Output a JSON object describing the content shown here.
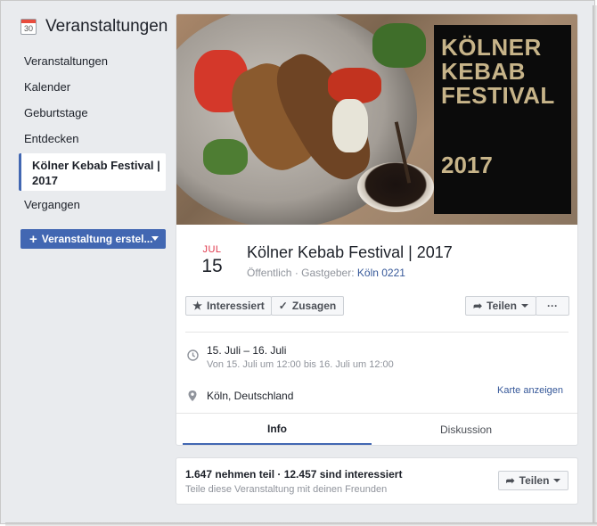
{
  "sidebar": {
    "calendar_day": "30",
    "title": "Veranstaltungen",
    "items": [
      {
        "label": "Veranstaltungen"
      },
      {
        "label": "Kalender"
      },
      {
        "label": "Geburtstage"
      },
      {
        "label": "Entdecken"
      },
      {
        "label": "Kölner Kebab Festival | 2017"
      },
      {
        "label": "Vergangen"
      }
    ],
    "create_button": "Veranstaltung erstel..."
  },
  "event": {
    "cover": {
      "poster_title": "KÖLNER KEBAB FESTIVAL",
      "poster_year": "2017"
    },
    "month": "JUL",
    "day": "15",
    "title": "Kölner Kebab Festival | 2017",
    "visibility": "Öffentlich",
    "host_prefix": "Gastgeber:",
    "host": "Köln 0221",
    "actions": {
      "interested": "Interessiert",
      "going": "Zusagen",
      "share": "Teilen",
      "more": "···"
    },
    "when_main": "15. Juli – 16. Juli",
    "when_sub": "Von 15. Juli um 12:00 bis 16. Juli um 12:00",
    "where": "Köln, Deutschland",
    "map_link": "Karte anzeigen",
    "tabs": [
      {
        "label": "Info",
        "active": true
      },
      {
        "label": "Diskussion",
        "active": false
      }
    ]
  },
  "attendance": {
    "stats": "1.647 nehmen teil · 12.457 sind interessiert",
    "sub": "Teile diese Veranstaltung mit deinen Freunden",
    "share": "Teilen"
  },
  "colors": {
    "accent": "#4267b2",
    "link": "#365899",
    "month": "#e0394d",
    "background": "#e9ebee"
  }
}
